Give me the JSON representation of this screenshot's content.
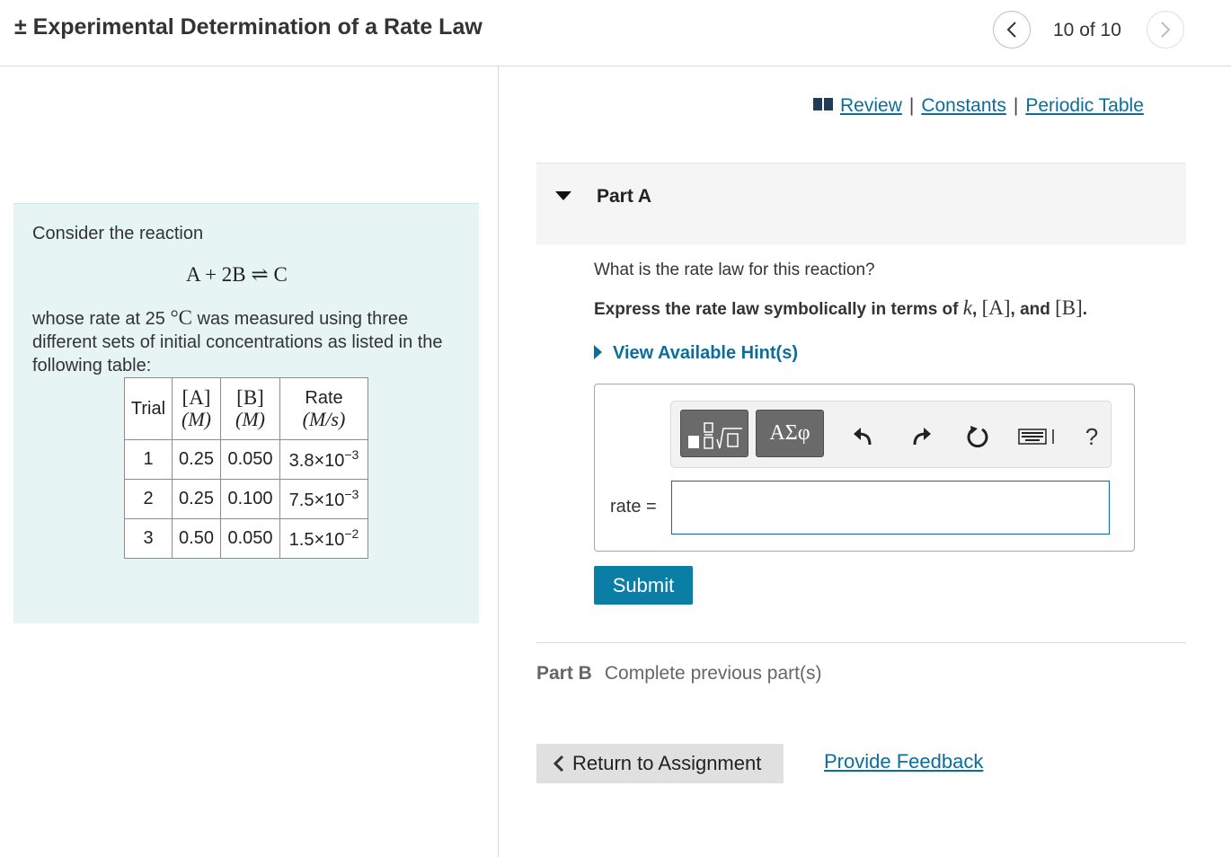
{
  "header": {
    "title": "± Experimental Determination of a Rate Law",
    "counter": "10 of 10"
  },
  "problem": {
    "intro": "Consider the reaction",
    "reaction": {
      "lhs": "A + 2B",
      "arrow": "⇌",
      "rhs": "C"
    },
    "description_pre": "whose rate at 25 ",
    "description_unit": "°C",
    "description_post": " was measured using three different sets of initial concentrations as listed in the following table:",
    "table": {
      "headers": [
        {
          "top": "Trial",
          "bottom": ""
        },
        {
          "top": "[A]",
          "bottom": "(M)"
        },
        {
          "top": "[B]",
          "bottom": "(M)"
        },
        {
          "top": "Rate",
          "bottom": "(M/s)"
        }
      ],
      "rows": [
        {
          "trial": "1",
          "a": "0.25",
          "b": "0.050",
          "rate_base": "3.8×10",
          "rate_exp": "−3"
        },
        {
          "trial": "2",
          "a": "0.25",
          "b": "0.100",
          "rate_base": "7.5×10",
          "rate_exp": "−3"
        },
        {
          "trial": "3",
          "a": "0.50",
          "b": "0.050",
          "rate_base": "1.5×10",
          "rate_exp": "−2"
        }
      ]
    }
  },
  "links": {
    "review": "Review",
    "sep": "|",
    "constants": "Constants",
    "periodic_table": "Periodic Table"
  },
  "part_a": {
    "title": "Part A",
    "question": "What is the rate law for this reaction?",
    "express_pre": "Express the rate law symbolically in terms of ",
    "var_k": "k",
    "var_a": "[A]",
    "var_b": "[B]",
    "comma": ",",
    "and": "and",
    "period": ".",
    "hint": "View Available Hint(s)",
    "toolbar": {
      "symbols_label": "ΑΣφ",
      "help_label": "?"
    },
    "input_label": "rate =",
    "input_value": "",
    "submit": "Submit"
  },
  "part_b": {
    "label": "Part B",
    "status": "Complete previous part(s)"
  },
  "footer": {
    "return": "Return to Assignment",
    "feedback": "Provide Feedback"
  },
  "colors": {
    "link": "#0c6d9b",
    "submit": "#0a7ea4",
    "panel": "#e6f4f4"
  }
}
